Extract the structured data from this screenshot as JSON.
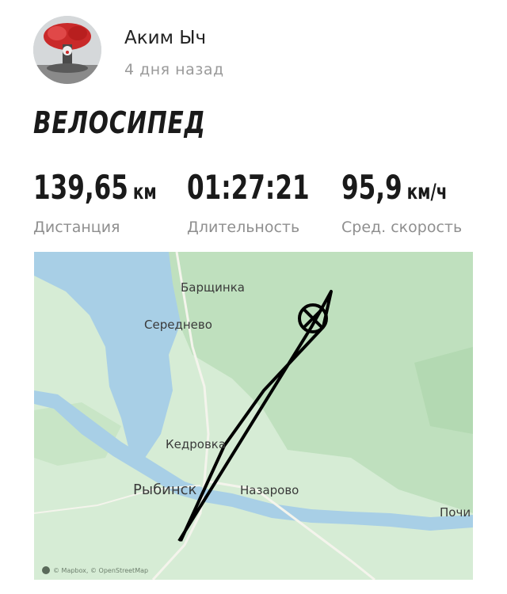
{
  "user": {
    "name": "Аким Ыч",
    "time_ago": "4 дня назад"
  },
  "activity": {
    "type": "ВЕЛОСИПЕД"
  },
  "stats": {
    "distance": {
      "value": "139,65",
      "unit": "км",
      "label": "Дистанция"
    },
    "duration": {
      "value": "01:27:21",
      "label": "Длительность"
    },
    "speed": {
      "value": "95,9",
      "unit": "км/ч",
      "label": "Сред. скорость"
    }
  },
  "map": {
    "places": {
      "barshchinka": "Барщинка",
      "serednevo": "Середнево",
      "kedrovka": "Кедровка",
      "rybinsk": "Рыбинск",
      "nazarovo": "Назарово",
      "pochi": "Почи"
    },
    "attribution": "© Mapbox, © OpenStreetMap",
    "colors": {
      "water": "#a8cfe6",
      "land": "#d6ecd5",
      "forest": "#b9ddb8",
      "route": "#000000"
    }
  }
}
